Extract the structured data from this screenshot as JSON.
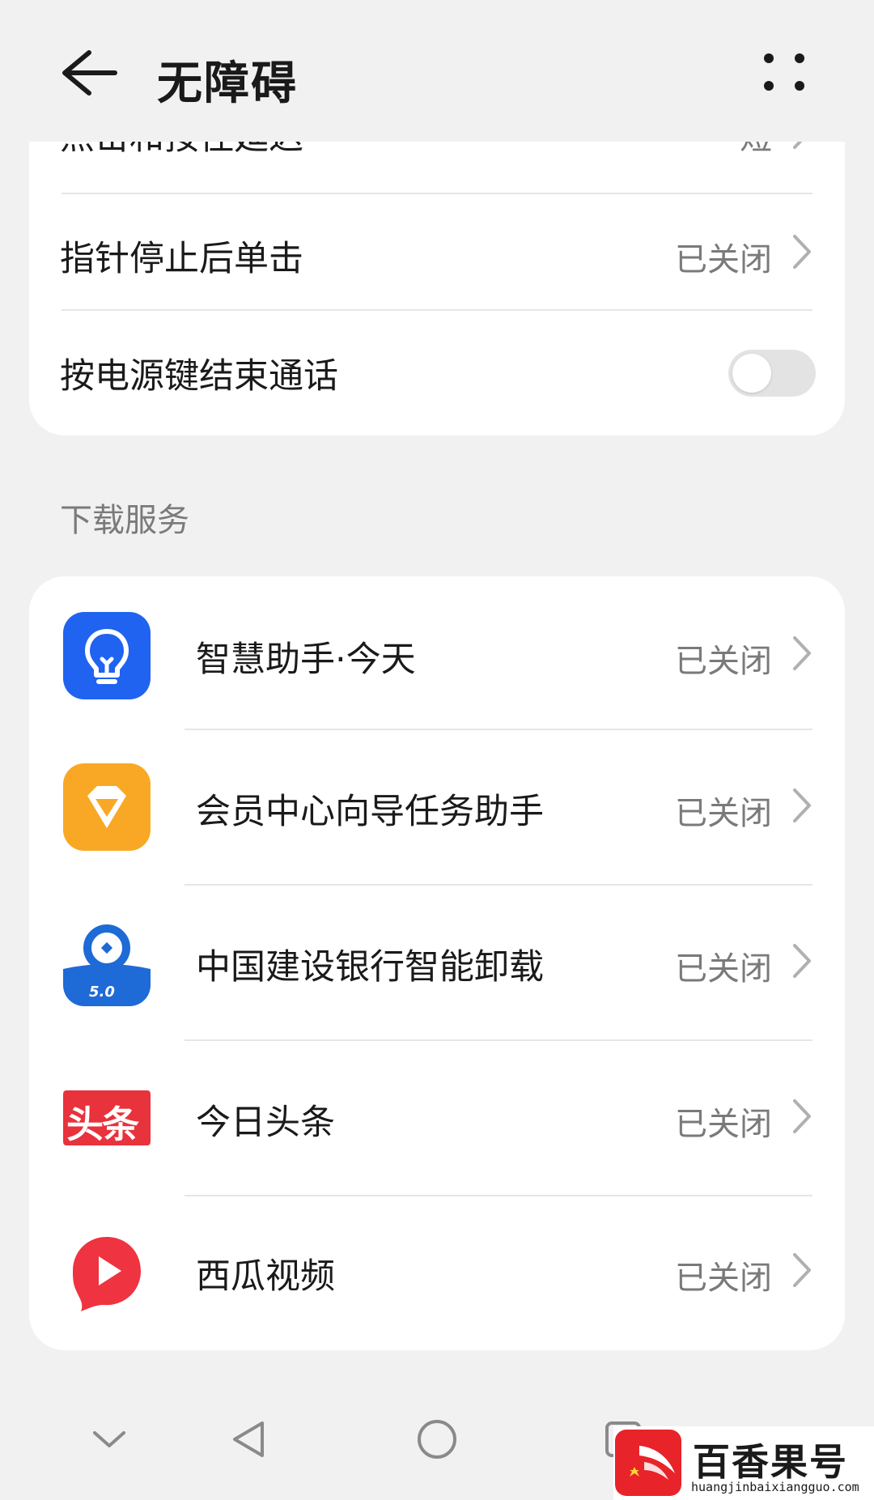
{
  "header": {
    "title": "无障碍"
  },
  "top_card": {
    "items": [
      {
        "label": "点击和按住延迟",
        "value": "短"
      },
      {
        "label": "指针停止后单击",
        "value": "已关闭"
      },
      {
        "label": "按电源键结束通话",
        "toggle_on": false
      }
    ]
  },
  "section": {
    "title": "下载服务"
  },
  "services": [
    {
      "name": "智慧助手·今天",
      "status": "已关闭",
      "icon": "lightbulb-icon",
      "color": "#1f63f0"
    },
    {
      "name": "会员中心向导任务助手",
      "status": "已关闭",
      "icon": "diamond-icon",
      "color": "#f9a825"
    },
    {
      "name": "中国建设银行智能卸载",
      "status": "已关闭",
      "icon": "ccb-icon",
      "color": "#1e6ad6",
      "icon_text": "5.0"
    },
    {
      "name": "今日头条",
      "status": "已关闭",
      "icon": "toutiao-icon",
      "color": "#e8323c",
      "icon_text": "头条"
    },
    {
      "name": "西瓜视频",
      "status": "已关闭",
      "icon": "xigua-icon",
      "color": "#ef3340"
    }
  ],
  "navbar": {
    "buttons": [
      "collapse-icon",
      "back-triangle-icon",
      "home-circle-icon",
      "recents-square-icon"
    ]
  },
  "watermark": {
    "brand": "百香果号",
    "url": "huangjinbaixiangguo.com"
  }
}
